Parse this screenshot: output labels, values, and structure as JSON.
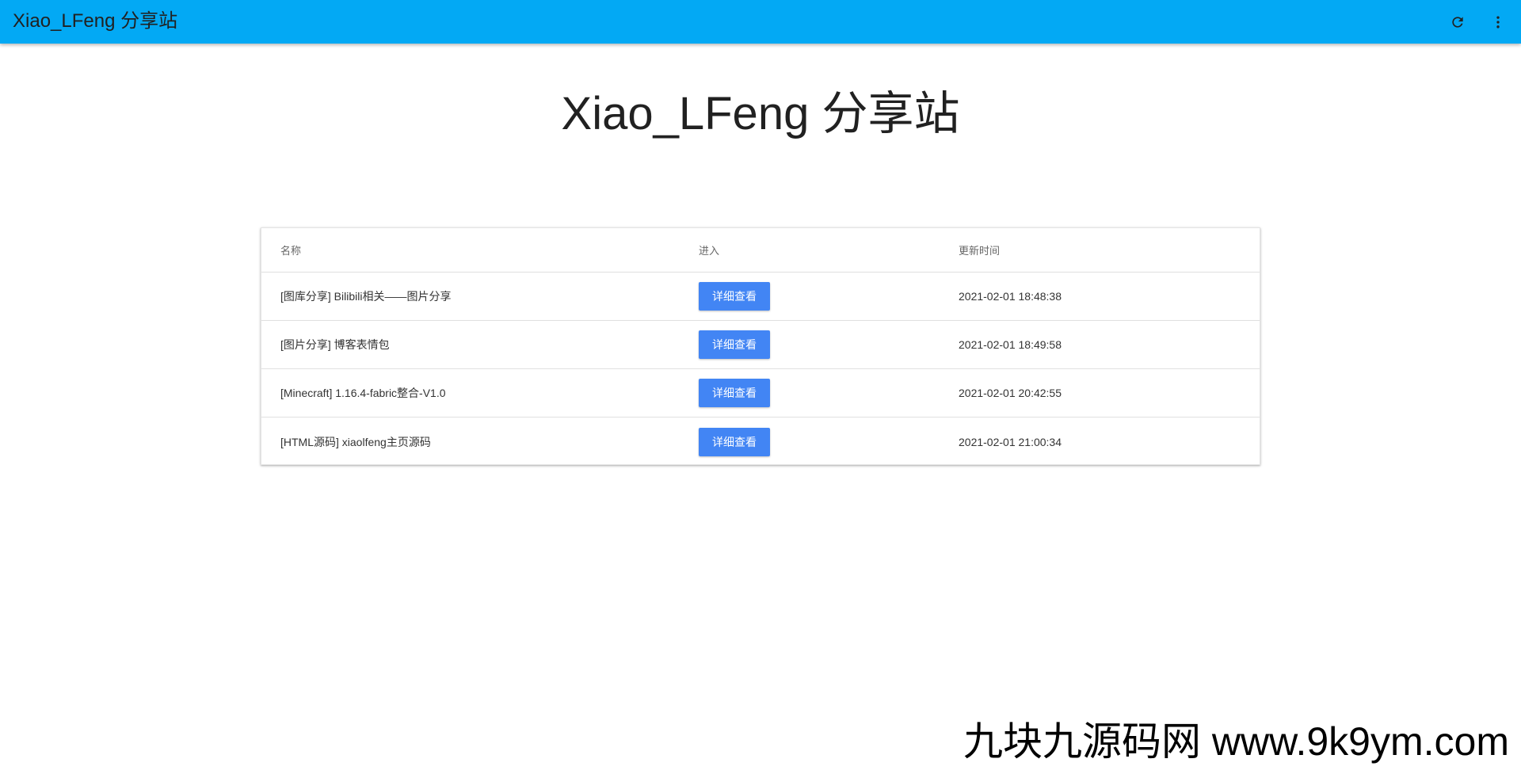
{
  "appbar": {
    "title": "Xiao_LFeng 分享站",
    "icons": [
      "refresh-icon",
      "more-vert-icon"
    ],
    "color": "#03a9f4"
  },
  "page": {
    "title": "Xiao_LFeng 分享站"
  },
  "table": {
    "headers": {
      "name": "名称",
      "enter": "进入",
      "time": "更新时间"
    },
    "rows": [
      {
        "name": "[图库分享] Bilibili相关——图片分享",
        "button": "详细查看",
        "time": "2021-02-01 18:48:38"
      },
      {
        "name": "[图片分享] 博客表情包",
        "button": "详细查看",
        "time": "2021-02-01 18:49:58"
      },
      {
        "name": "[Minecraft] 1.16.4-fabric整合-V1.0",
        "button": "详细查看",
        "time": "2021-02-01 20:42:55"
      },
      {
        "name": "[HTML源码] xiaolfeng主页源码",
        "button": "详细查看",
        "time": "2021-02-01 21:00:34"
      }
    ],
    "button_color": "#4285f4"
  },
  "watermark": {
    "text": "九块九源码网 www.9k9ym.com"
  }
}
